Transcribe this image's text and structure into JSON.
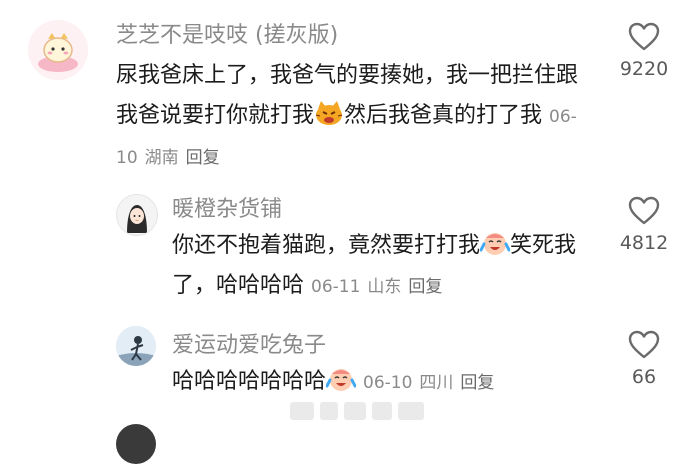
{
  "comments": [
    {
      "username": "芝芝不是吱吱 (搓灰版)",
      "text": "尿我爸床上了，我爸气的要揍她，我一把拦住跟我爸说要打你就打我",
      "emoji": "angry-cat-emoji",
      "text_after": "然后我爸真的打了我",
      "date": "06-10",
      "location": "湖南",
      "reply": "回复",
      "likes": "9220"
    },
    {
      "username": "暖橙杂货铺",
      "text": "你还不抱着猫跑，竟然要打打我",
      "emoji": "crying-laughing-emoji",
      "text_after": "笑死我了，哈哈哈哈",
      "date": "06-11",
      "location": "山东",
      "reply": "回复",
      "likes": "4812"
    },
    {
      "username": "爱运动爱吃兔子",
      "text": "哈哈哈哈哈哈哈",
      "emoji": "crying-laughing-emoji",
      "text_after": "",
      "date": "06-10",
      "location": "四川",
      "reply": "回复",
      "likes": "66"
    }
  ],
  "icons": {
    "like": "heart-outline-icon"
  },
  "colors": {
    "text": "#1c1c1c",
    "meta": "#8a8a8a",
    "heart": "#6b6b6b"
  }
}
